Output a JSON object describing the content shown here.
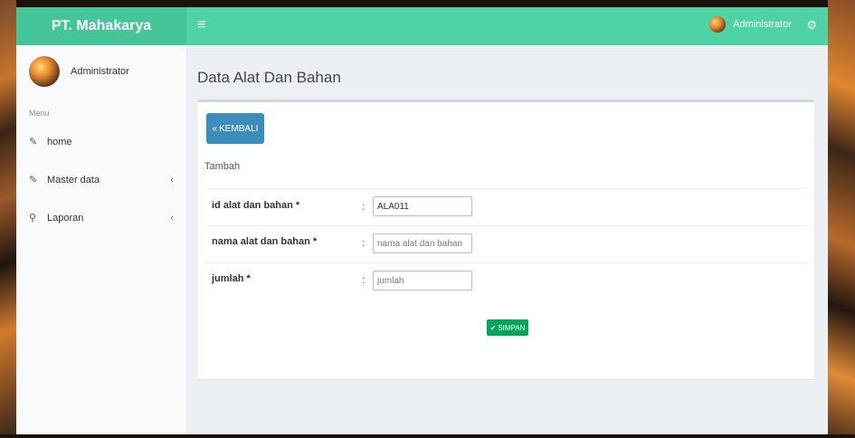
{
  "header": {
    "brand": "PT. Mahakarya",
    "menu_icon": "hamburger-icon",
    "user_name": "Administrator",
    "settings_icon": "gears-icon"
  },
  "sidebar": {
    "user_name": "Administrator",
    "menu_header": "Menu",
    "items": [
      {
        "label": "home",
        "icon": "edit-icon",
        "has_submenu": false
      },
      {
        "label": "Master data",
        "icon": "edit-icon",
        "has_submenu": true
      },
      {
        "label": "Laporan",
        "icon": "sitemap-icon",
        "has_submenu": true
      }
    ]
  },
  "content": {
    "title": "Data Alat Dan Bahan",
    "back_button": "KEMBALI",
    "box_subtitle": "Tambah",
    "fields": [
      {
        "label": "id alat dan bahan *",
        "value": "ALA011",
        "placeholder": ""
      },
      {
        "label": "nama alat dan bahan *",
        "value": "",
        "placeholder": "nama alat dan bahan"
      },
      {
        "label": "jumlah *",
        "value": "",
        "placeholder": "jumlah"
      }
    ],
    "colon": ":",
    "save_button": "SIMPAN"
  },
  "colors": {
    "header": "#4fd3a4",
    "brand_bg": "#44c698",
    "back_button": "#3c8dbc",
    "save_button": "#00a65a",
    "content_bg": "#ecf0f5"
  }
}
